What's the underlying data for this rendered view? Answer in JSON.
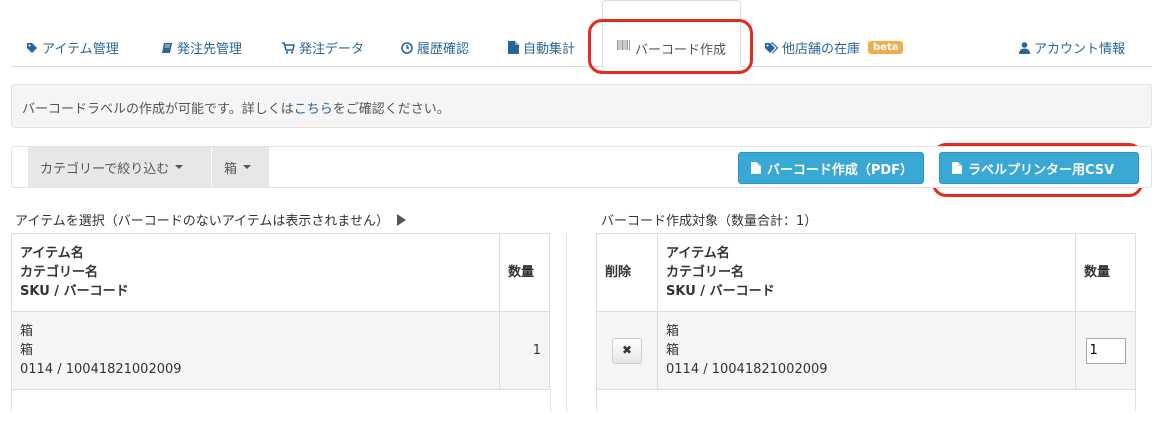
{
  "nav": {
    "items": [
      {
        "label": "アイテム管理",
        "icon": "tag-icon"
      },
      {
        "label": "発注先管理",
        "icon": "book-icon"
      },
      {
        "label": "発注データ",
        "icon": "cart-icon"
      },
      {
        "label": "履歴確認",
        "icon": "clock-icon"
      },
      {
        "label": "自動集計",
        "icon": "file-icon"
      },
      {
        "label": "バーコード作成",
        "icon": "barcode-icon",
        "active": true
      },
      {
        "label": "他店舗の在庫",
        "icon": "tags-icon",
        "badge": "beta"
      },
      {
        "label": "アカウント情報",
        "icon": "user-icon"
      }
    ]
  },
  "info": {
    "before": "バーコードラベルの作成が可能です。詳しくは",
    "link": "こちら",
    "after": "をご確認ください。"
  },
  "toolbar": {
    "category_filter": "カテゴリーで絞り込む",
    "category_value": "箱",
    "pdf_button": "バーコード作成（PDF）",
    "csv_button": "ラベルプリンター用CSV"
  },
  "left": {
    "title": "アイテムを選択（バーコードのないアイテムは表示されません）",
    "headers": {
      "name": "アイテム名",
      "category": "カテゴリー名",
      "sku": "SKU / バーコード",
      "qty": "数量"
    },
    "rows": [
      {
        "name": "箱",
        "category": "箱",
        "sku": "0114 / 10041821002009",
        "qty": "1"
      }
    ]
  },
  "right": {
    "title": "バーコード作成対象（数量合計：1）",
    "headers": {
      "delete": "削除",
      "name": "アイテム名",
      "category": "カテゴリー名",
      "sku": "SKU / バーコード",
      "qty": "数量"
    },
    "rows": [
      {
        "name": "箱",
        "category": "箱",
        "sku": "0114 / 10041821002009",
        "qty": "1",
        "delete_glyph": "✖"
      }
    ]
  },
  "colors": {
    "link": "#2a6496",
    "accent": "#39a8d4",
    "highlight": "#e8291c",
    "badge": "#f0ad4e"
  }
}
